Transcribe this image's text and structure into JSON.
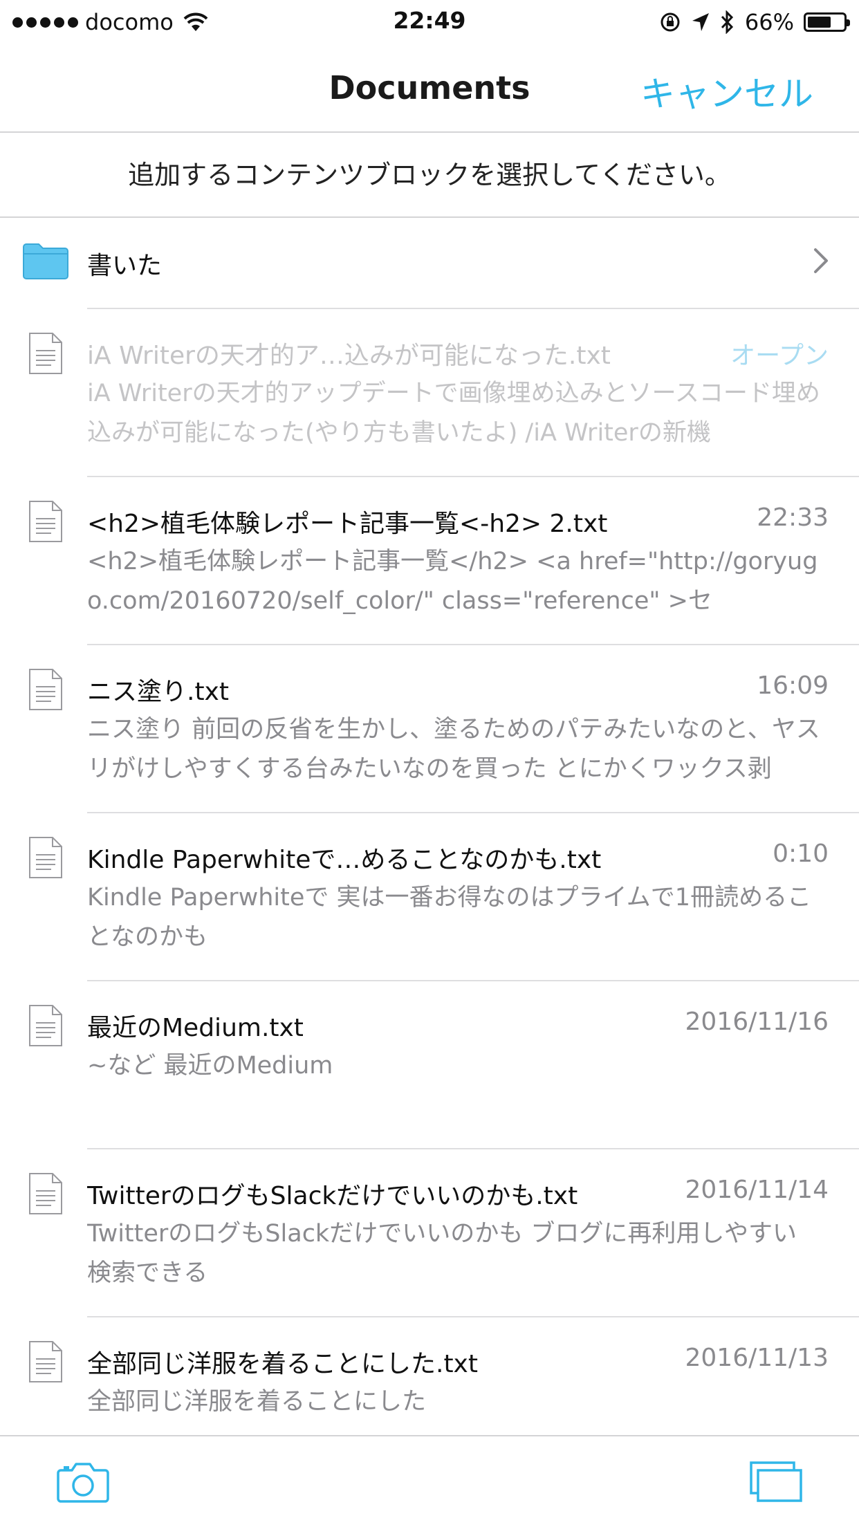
{
  "status_bar": {
    "carrier": "docomo",
    "time": "22:49",
    "battery": "66%",
    "battery_level": 0.66
  },
  "nav": {
    "title": "Documents",
    "cancel": "キャンセル"
  },
  "instruction": "追加するコンテンツブロックを選択してください。",
  "folder": {
    "label": "書いた"
  },
  "documents": [
    {
      "title": "iA Writerの天才的ア…込みが可能になった.txt",
      "date": "オープン",
      "preview": "iA Writerの天才的アップデートで画像埋め込みとソースコード埋め込みが可能になった(やり方も書いたよ) /iA Writerの新機",
      "disabled": true
    },
    {
      "title": "<h2>植毛体験レポート記事一覧<-h2> 2.txt",
      "date": "22:33",
      "preview": "<h2>植毛体験レポート記事一覧</h2> <a href=\"http://goryugo.com/20160720/self_color/\" class=\"reference\" >セ",
      "disabled": false
    },
    {
      "title": "ニス塗り.txt",
      "date": "16:09",
      "preview": "ニス塗り 前回の反省を生かし、塗るためのパテみたいなのと、ヤスリがけしやすくする台みたいなのを買った とにかくワックス剥",
      "disabled": false
    },
    {
      "title": "Kindle Paperwhiteで…めることなのかも.txt",
      "date": "0:10",
      "preview": "Kindle Paperwhiteで 実は一番お得なのはプライムで1冊読めることなのかも",
      "disabled": false
    },
    {
      "title": "最近のMedium.txt",
      "date": "2016/11/16",
      "preview": "~など 最近のMedium",
      "disabled": false
    },
    {
      "title": "TwitterのログもSlackだけでいいのかも.txt",
      "date": "2016/11/14",
      "preview": "TwitterのログもSlackだけでいいのかも ブログに再利用しやすい 検索できる",
      "disabled": false
    },
    {
      "title": "全部同じ洋服を着ることにした.txt",
      "date": "2016/11/13",
      "preview": "全部同じ洋服を着ることにした",
      "disabled": false
    }
  ],
  "colors": {
    "accent": "#2fb6e8",
    "folder": "#5ec6f0",
    "secondary_text": "#8a8a8e"
  }
}
